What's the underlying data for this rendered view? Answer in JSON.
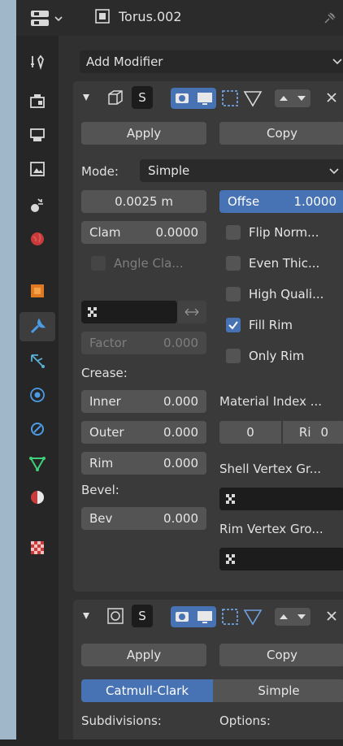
{
  "header": {
    "object_name": "Torus.002",
    "icons": [
      "editor-type-icon",
      "mesh-object-icon",
      "pin-icon"
    ]
  },
  "tabs": [
    {
      "name": "tool",
      "icon": "tool-icon"
    },
    {
      "name": "render",
      "icon": "render-icon"
    },
    {
      "name": "output",
      "icon": "output-icon"
    },
    {
      "name": "view-layer",
      "icon": "view-layer-icon"
    },
    {
      "name": "scene",
      "icon": "scene-icon"
    },
    {
      "name": "world",
      "icon": "world-icon"
    },
    {
      "name": "object",
      "icon": "object-icon"
    },
    {
      "name": "modifiers",
      "icon": "wrench-icon",
      "active": true
    },
    {
      "name": "particles",
      "icon": "particles-icon"
    },
    {
      "name": "physics",
      "icon": "physics-icon"
    },
    {
      "name": "constraints",
      "icon": "constraints-icon"
    },
    {
      "name": "data",
      "icon": "mesh-data-icon"
    },
    {
      "name": "material",
      "icon": "material-icon"
    },
    {
      "name": "texture",
      "icon": "texture-icon"
    }
  ],
  "add_modifier": {
    "label": "Add Modifier"
  },
  "solidify": {
    "name_short": "S",
    "apply": "Apply",
    "copy": "Copy",
    "mode_label": "Mode:",
    "mode_value": "Simple",
    "thickness": "0.0025 m",
    "offset_label": "Offse",
    "offset_value": "1.0000",
    "clamp_label": "Clam",
    "clamp_value": "0.0000",
    "angle_clamp": "Angle Cla...",
    "flip_normals": "Flip Norm...",
    "even_thickness": "Even Thic...",
    "high_quality": "High Quali...",
    "fill_rim": "Fill Rim",
    "only_rim": "Only Rim",
    "factor_label": "Factor",
    "factor_value": "0.000",
    "crease_label": "Crease:",
    "inner_label": "Inner",
    "inner_value": "0.000",
    "outer_label": "Outer",
    "outer_value": "0.000",
    "rim_label": "Rim",
    "rim_value": "0.000",
    "material_index_label": "Material Index ...",
    "mat_index_value": "0",
    "mat_rim_label": "Ri",
    "mat_rim_value": "0",
    "bevel_label": "Bevel:",
    "bev_label": "Bev",
    "bev_value": "0.000",
    "shell_vertex_group": "Shell Vertex Gr...",
    "rim_vertex_group": "Rim Vertex Gro...",
    "fill_rim_checked": true
  },
  "subsurf": {
    "name_short": "S",
    "apply": "Apply",
    "copy": "Copy",
    "catmull_clark": "Catmull-Clark",
    "simple": "Simple",
    "subdivisions_label": "Subdivisions:",
    "options_label": "Options:"
  },
  "colors": {
    "accent": "#4772b3",
    "panel": "#3a3a3a",
    "background": "#303030",
    "button": "#545454"
  }
}
